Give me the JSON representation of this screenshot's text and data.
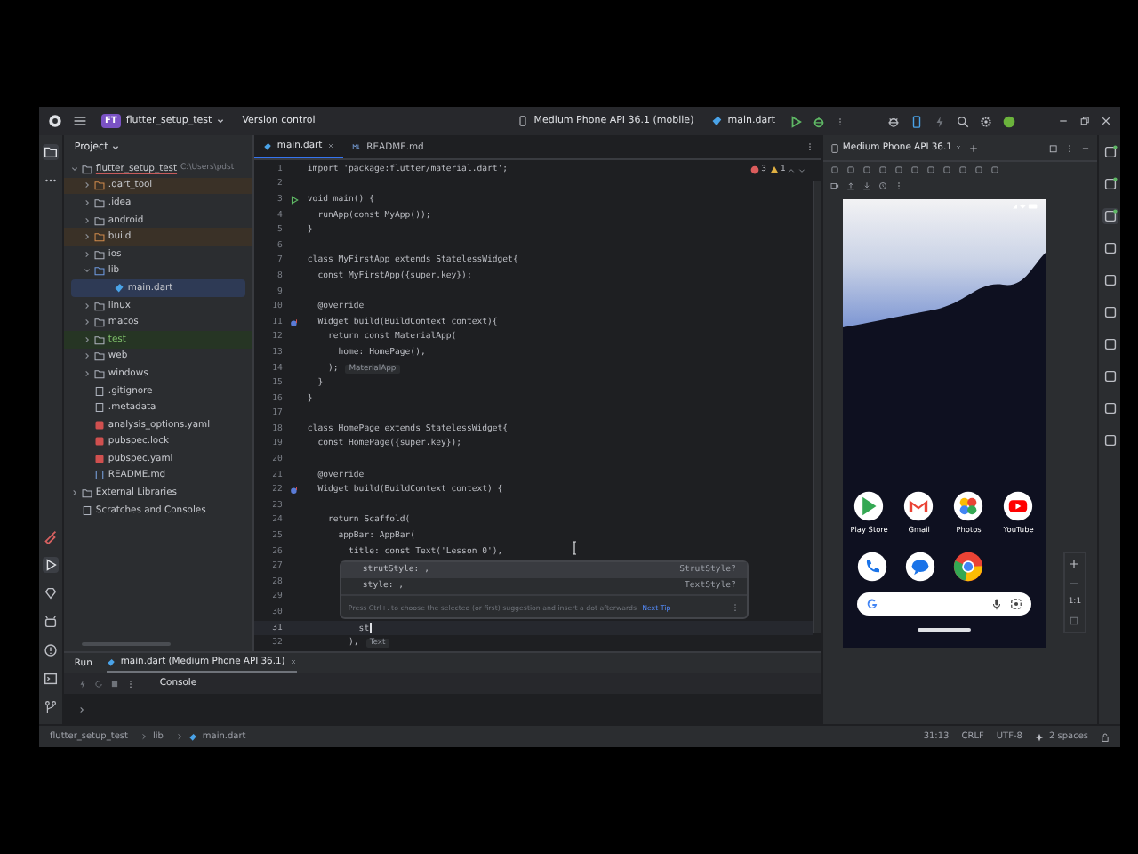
{
  "title_bar": {
    "project_badge": "FT",
    "project": "flutter_setup_test",
    "vcs": "Version control",
    "device": "Medium Phone API 36.1 (mobile)",
    "run_config": "main.dart"
  },
  "project_panel": {
    "title": "Project",
    "tree": [
      {
        "label": "flutter_setup_test",
        "path": "C:\\Users\\pdst",
        "kind": "module",
        "expanded": true,
        "selected": false,
        "children": [
          {
            "label": ".dart_tool",
            "kind": "folder",
            "expanded": false,
            "selected": false,
            "excluded": true,
            "test_source": false
          },
          {
            "label": ".idea",
            "kind": "folder",
            "expanded": false,
            "selected": false,
            "excluded": false,
            "test_source": false
          },
          {
            "label": "android",
            "kind": "folder",
            "expanded": false,
            "selected": false,
            "excluded": false,
            "test_source": false
          },
          {
            "label": "build",
            "kind": "folder",
            "expanded": false,
            "selected": false,
            "excluded": true,
            "test_source": false
          },
          {
            "label": "ios",
            "kind": "folder",
            "expanded": false,
            "selected": false,
            "excluded": false,
            "test_source": false
          },
          {
            "label": "lib",
            "kind": "folder",
            "expanded": true,
            "selected": false,
            "excluded": false,
            "test_source": false,
            "children": [
              {
                "label": "main.dart",
                "kind": "dart",
                "selected": true
              }
            ]
          },
          {
            "label": "linux",
            "kind": "folder",
            "expanded": false,
            "selected": false,
            "excluded": false,
            "test_source": false
          },
          {
            "label": "macos",
            "kind": "folder",
            "expanded": false,
            "selected": false,
            "excluded": false,
            "test_source": false
          },
          {
            "label": "test",
            "kind": "folder",
            "expanded": false,
            "selected": false,
            "excluded": false,
            "test_source": true
          },
          {
            "label": "web",
            "kind": "folder",
            "expanded": false,
            "selected": false,
            "excluded": false,
            "test_source": false
          },
          {
            "label": "windows",
            "kind": "folder",
            "expanded": false,
            "selected": false,
            "excluded": false,
            "test_source": false
          },
          {
            "label": ".gitignore",
            "kind": "ignore",
            "selected": false
          },
          {
            "label": ".metadata",
            "kind": "text",
            "selected": false
          },
          {
            "label": "analysis_options.yaml",
            "kind": "yaml",
            "selected": false
          },
          {
            "label": "pubspec.lock",
            "kind": "yaml",
            "selected": false
          },
          {
            "label": "pubspec.yaml",
            "kind": "yaml",
            "selected": false
          },
          {
            "label": "README.md",
            "kind": "markdown",
            "selected": false
          }
        ]
      },
      {
        "label": "External Libraries",
        "kind": "library",
        "expanded": false,
        "selected": false
      },
      {
        "label": "Scratches and Consoles",
        "kind": "scratch",
        "selected": false
      }
    ]
  },
  "editor": {
    "tabs": [
      {
        "label": "main.dart",
        "kind": "dart",
        "selected": true,
        "closable": true
      },
      {
        "label": "README.md",
        "kind": "markdown",
        "selected": false,
        "closable": false
      }
    ],
    "errors": "3",
    "warnings": "1",
    "lines": [
      {
        "n": "1",
        "text": "import 'package:flutter/material.dart';",
        "runnable": false,
        "overrides": false,
        "current": false
      },
      {
        "n": "2",
        "runnable": false,
        "overrides": false,
        "current": false
      },
      {
        "n": "3",
        "text": "void main() {",
        "runnable": true,
        "overrides": false,
        "current": false
      },
      {
        "n": "4",
        "text": "  runApp(const MyApp());",
        "runnable": false,
        "overrides": false,
        "current": false
      },
      {
        "n": "5",
        "text": "}",
        "runnable": false,
        "overrides": false,
        "current": false
      },
      {
        "n": "6",
        "runnable": false,
        "overrides": false,
        "current": false
      },
      {
        "n": "7",
        "text": "class MyFirstApp extends StatelessWidget{",
        "runnable": false,
        "overrides": false,
        "current": false
      },
      {
        "n": "8",
        "text": "  const MyFirstApp({super.key});",
        "runnable": false,
        "overrides": false,
        "current": false
      },
      {
        "n": "9",
        "runnable": false,
        "overrides": false,
        "current": false
      },
      {
        "n": "10",
        "text": "  @override",
        "runnable": false,
        "overrides": false,
        "current": false
      },
      {
        "n": "11",
        "text": "  Widget build(BuildContext context){",
        "runnable": false,
        "overrides": true,
        "current": false
      },
      {
        "n": "12",
        "text": "    return const MaterialApp(",
        "runnable": false,
        "overrides": false,
        "current": false
      },
      {
        "n": "13",
        "text": "      home: HomePage(),",
        "runnable": false,
        "overrides": false,
        "current": false
      },
      {
        "n": "14",
        "text": "    );",
        "hint": "MaterialApp",
        "runnable": false,
        "overrides": false,
        "current": false
      },
      {
        "n": "15",
        "text": "  }",
        "runnable": false,
        "overrides": false,
        "current": false
      },
      {
        "n": "16",
        "text": "}",
        "runnable": false,
        "overrides": false,
        "current": false
      },
      {
        "n": "17",
        "runnable": false,
        "overrides": false,
        "current": false
      },
      {
        "n": "18",
        "text": "class HomePage extends StatelessWidget{",
        "runnable": false,
        "overrides": false,
        "current": false
      },
      {
        "n": "19",
        "text": "  const HomePage({super.key});",
        "runnable": false,
        "overrides": false,
        "current": false
      },
      {
        "n": "20",
        "runnable": false,
        "overrides": false,
        "current": false
      },
      {
        "n": "21",
        "text": "  @override",
        "runnable": false,
        "overrides": false,
        "current": false
      },
      {
        "n": "22",
        "text": "  Widget build(BuildContext context) {",
        "runnable": false,
        "overrides": true,
        "current": false
      },
      {
        "n": "23",
        "runnable": false,
        "overrides": false,
        "current": false
      },
      {
        "n": "24",
        "text": "    return Scaffold(",
        "runnable": false,
        "overrides": false,
        "current": false
      },
      {
        "n": "25",
        "text": "      appBar: AppBar(",
        "runnable": false,
        "overrides": false,
        "current": false
      },
      {
        "n": "26",
        "text": "        title: const Text('Lesson 0'),",
        "runnable": false,
        "overrides": false,
        "current": false
      },
      {
        "n": "27",
        "runnable": false,
        "overrides": false,
        "current": false
      },
      {
        "n": "28",
        "runnable": false,
        "overrides": false,
        "current": false
      },
      {
        "n": "29",
        "runnable": false,
        "overrides": false,
        "current": false
      },
      {
        "n": "30",
        "runnable": false,
        "overrides": false,
        "current": false
      },
      {
        "n": "31",
        "text": "          st",
        "runnable": false,
        "overrides": false,
        "current": true
      },
      {
        "n": "32",
        "text": "        ),",
        "hint": "Text",
        "runnable": false,
        "overrides": false,
        "current": false
      }
    ],
    "completion": {
      "items": [
        {
          "label": "strutStyle: ,",
          "type": "StrutStyle?",
          "selected": true
        },
        {
          "label": "style: ,",
          "type": "TextStyle?",
          "selected": false
        }
      ],
      "footer": "Press Ctrl+. to choose the selected (or first) suggestion and insert a dot afterwards",
      "tip_link": "Next Tip"
    }
  },
  "run_panel": {
    "title": "Run",
    "tab": "main.dart (Medium Phone API 36.1)",
    "console": "Console"
  },
  "emulator": {
    "tab": "Medium Phone API 36.1",
    "apps": [
      "Play Store",
      "Gmail",
      "Photos",
      "YouTube"
    ],
    "zoom_reset": "1:1"
  },
  "status_bar": {
    "breadcrumb": [
      "flutter_setup_test",
      "lib",
      "main.dart"
    ],
    "position": "31:13",
    "line_ending": "CRLF",
    "encoding": "UTF-8",
    "indent": "2 spaces"
  }
}
